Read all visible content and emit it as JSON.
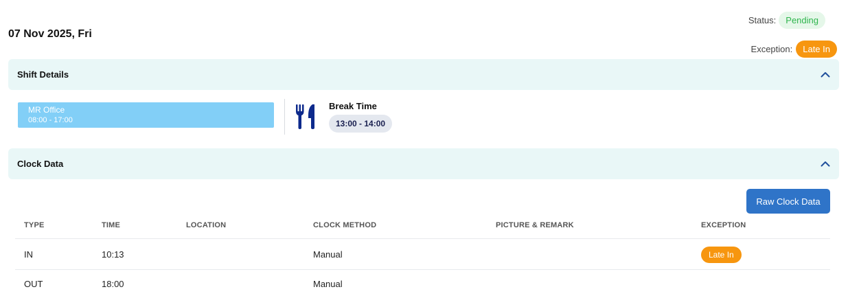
{
  "date_title": "07 Nov 2025, Fri",
  "status": {
    "label": "Status:",
    "value": "Pending"
  },
  "exception": {
    "label": "Exception:",
    "value": "Late In"
  },
  "shift_section": {
    "title": "Shift Details",
    "shift": {
      "name": "MR Office",
      "hours": "08:00 - 17:00"
    },
    "break": {
      "title": "Break Time",
      "time": "13:00 - 14:00",
      "icon": "fork-knife-icon"
    }
  },
  "clock_section": {
    "title": "Clock Data",
    "raw_button": "Raw Clock Data",
    "columns": [
      "TYPE",
      "TIME",
      "LOCATION",
      "CLOCK METHOD",
      "PICTURE & REMARK",
      "EXCEPTION"
    ],
    "rows": [
      {
        "type": "IN",
        "time": "10:13",
        "location": "",
        "method": "Manual",
        "remark": "",
        "exception": "Late In"
      },
      {
        "type": "OUT",
        "time": "18:00",
        "location": "",
        "method": "Manual",
        "remark": "",
        "exception": ""
      }
    ]
  },
  "colors": {
    "accent": "#2f74c8",
    "late": "#f7960f",
    "pending": "#2fb54d",
    "shift": "#82cff7",
    "section_bg": "#e9f7f7"
  }
}
